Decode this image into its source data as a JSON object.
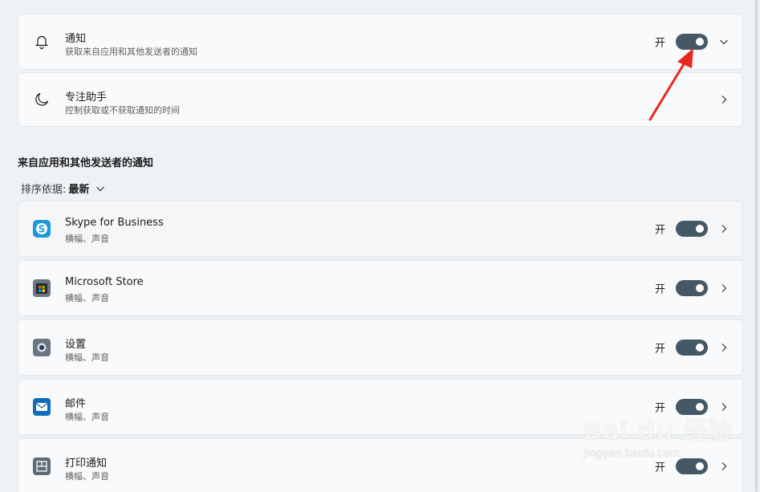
{
  "top_cards": [
    {
      "icon": "bell-icon",
      "title": "通知",
      "subtitle": "获取来自应用和其他发送者的通知",
      "state": "开",
      "toggle_on": true,
      "chevron": "chevron-down-icon"
    },
    {
      "icon": "moon-icon",
      "title": "专注助手",
      "subtitle": "控制获取或不获取通知的时间",
      "chevron": "chevron-right-icon"
    }
  ],
  "section": {
    "title": "来自应用和其他发送者的通知",
    "sort_label": "排序依据:",
    "sort_value": "最新"
  },
  "apps": [
    {
      "icon": "skype-icon",
      "name": "Skype for Business",
      "detail": "横幅、声音",
      "state": "开",
      "toggle_on": true
    },
    {
      "icon": "microsoft-store-icon",
      "name": "Microsoft Store",
      "detail": "横幅、声音",
      "state": "开",
      "toggle_on": true
    },
    {
      "icon": "settings-gear-icon",
      "name": "设置",
      "detail": "横幅、声音",
      "state": "开",
      "toggle_on": true
    },
    {
      "icon": "mail-icon",
      "name": "邮件",
      "detail": "横幅、声音",
      "state": "开",
      "toggle_on": true
    },
    {
      "icon": "print-notification-icon",
      "name": "打印通知",
      "detail": "横幅、声音",
      "state": "开",
      "toggle_on": true
    }
  ],
  "watermark": {
    "main": "Bai du 经验",
    "sub": "jingyan.baidu.com"
  },
  "colors": {
    "toggle_on": "#455866",
    "annotation_arrow": "#e8281f"
  }
}
